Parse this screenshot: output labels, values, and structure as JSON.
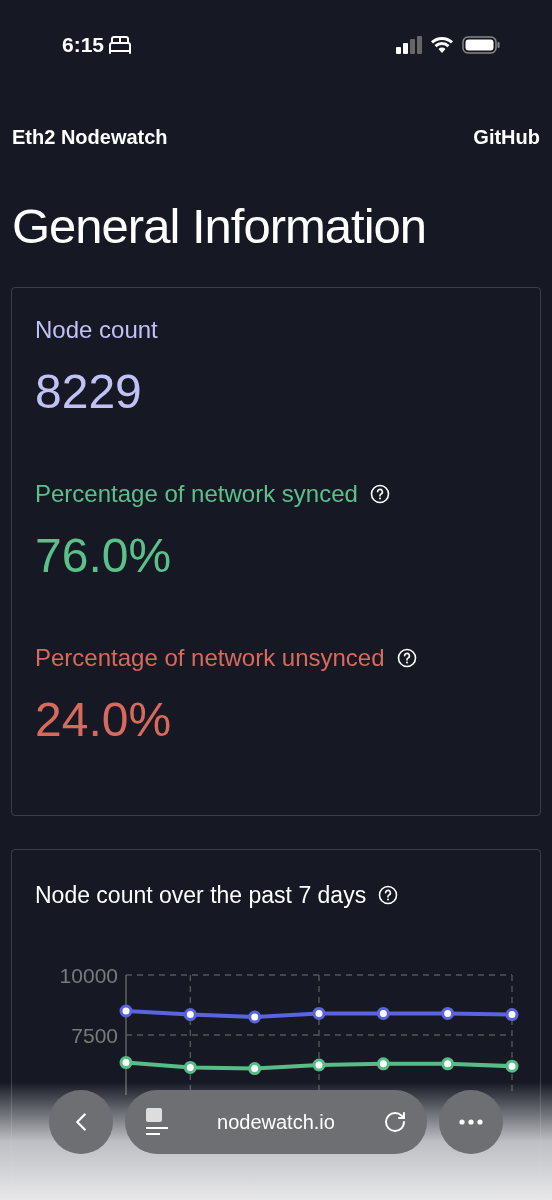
{
  "status_bar": {
    "time": "6:15"
  },
  "nav": {
    "brand": "Eth2 Nodewatch",
    "link": "GitHub"
  },
  "title": "General Information",
  "stats": [
    {
      "label": "Node count",
      "value": "8229",
      "color": "#c0c1f5",
      "help": false
    },
    {
      "label": "Percentage of network synced",
      "value": "76.0%",
      "color": "#5cc08a",
      "help": true
    },
    {
      "label": "Percentage of network unsynced",
      "value": "24.0%",
      "color": "#d76a5c",
      "help": true
    }
  ],
  "chart_card": {
    "title": "Node count over the past 7 days",
    "help": true,
    "chart_data": {
      "type": "line",
      "ylim": [
        5000,
        10000
      ],
      "yticks": [
        7500,
        10000
      ],
      "grid": true,
      "series": [
        {
          "color": "#5b64df",
          "marker": true,
          "values": [
            8500,
            8350,
            8250,
            8400,
            8400,
            8400,
            8350
          ]
        },
        {
          "color": "#56bd86",
          "marker": true,
          "values": [
            6350,
            6150,
            6100,
            6250,
            6300,
            6300,
            6200
          ]
        }
      ]
    }
  },
  "browser_bar": {
    "url": "nodewatch.io"
  }
}
